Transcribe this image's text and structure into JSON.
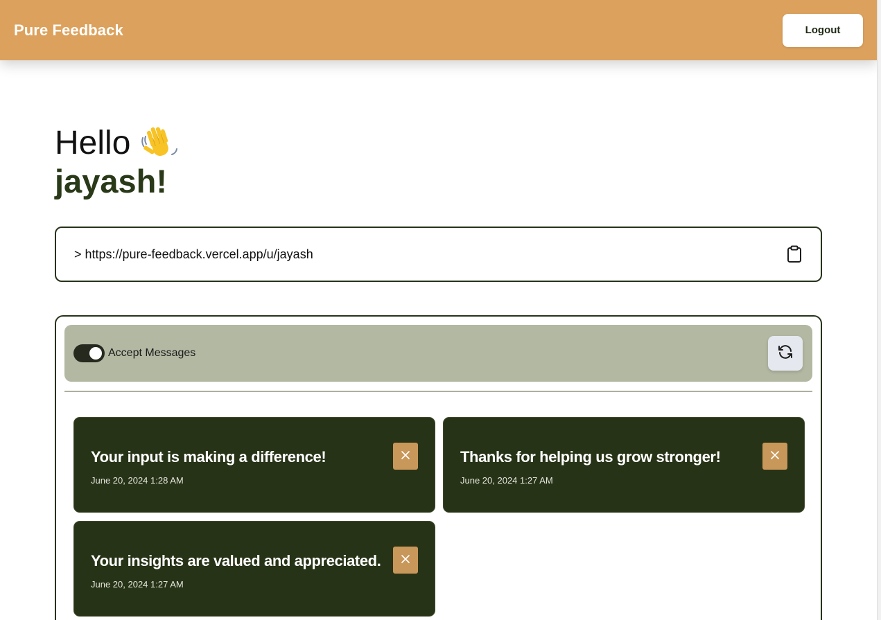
{
  "header": {
    "brand": "Pure Feedback",
    "logout_label": "Logout"
  },
  "greeting": {
    "hello": "Hello",
    "wave_icon": "waving-hand-icon",
    "username": "jayash!"
  },
  "profile_link": {
    "text": "> https://pure-feedback.vercel.app/u/jayash",
    "copy_icon": "clipboard-icon"
  },
  "messages": {
    "accept_label": "Accept Messages",
    "accept_enabled": true,
    "refresh_icon": "refresh-icon",
    "items": [
      {
        "content": "Your input is making a difference!",
        "date": "June 20, 2024 1:28 AM"
      },
      {
        "content": "Thanks for helping us grow stronger!",
        "date": "June 20, 2024 1:27 AM"
      },
      {
        "content": "Your insights are valued and appreciated.",
        "date": "June 20, 2024 1:27 AM"
      }
    ],
    "delete_icon": "close-icon"
  },
  "colors": {
    "navbar": "#dca15c",
    "accent_dark": "#273316",
    "delete_button": "#c8975a",
    "toolbar": "#b2b8a2"
  }
}
